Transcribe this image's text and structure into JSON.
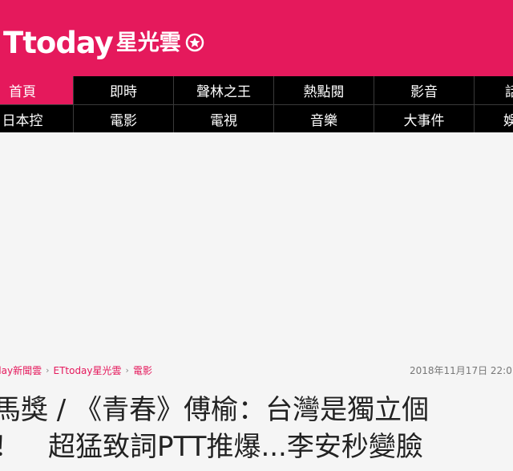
{
  "brand": {
    "logo_text": "Ttoday",
    "logo_sub": "星光雲",
    "accent": "#e5195c"
  },
  "nav": {
    "row1": [
      "首頁",
      "即時",
      "聲林之王",
      "熱點閱",
      "影音",
      "話"
    ],
    "row2": [
      "日本控",
      "電影",
      "電視",
      "音樂",
      "大事件",
      "娛"
    ]
  },
  "breadcrumb": [
    "day新聞雲",
    "ETtoday星光雲",
    "電影"
  ],
  "date": "2018年11月17日 22:0",
  "headline": {
    "line1": "馬獎 / 《青春》傅榆：台灣是獨立個",
    "line2": "！　超猛致詞PTT推爆...李安秒變臉"
  }
}
